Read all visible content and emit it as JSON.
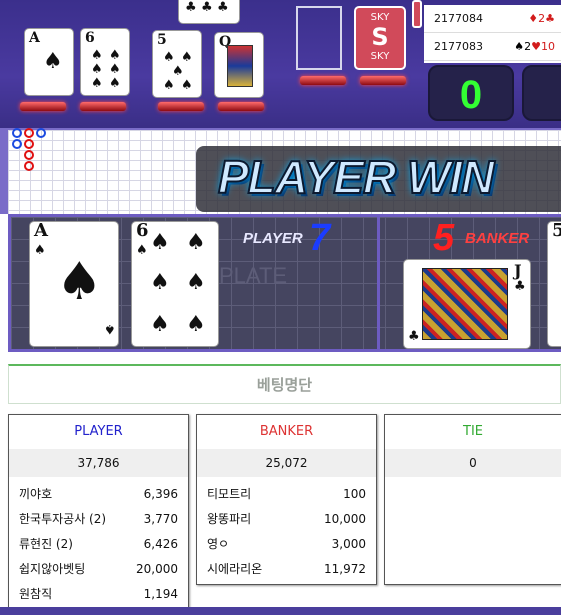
{
  "history": [
    {
      "round": "2177084",
      "result_dark": "",
      "result_red": "♦2♣"
    },
    {
      "round": "2177083",
      "result_dark": "♠2",
      "result_red": "♥10"
    }
  ],
  "scores_top": {
    "player_score": "0"
  },
  "banner": {
    "text": "PLAYER WIN"
  },
  "result": {
    "player_label": "PLAYER",
    "player_score": "7",
    "banker_label": "BANKER",
    "banker_score": "5",
    "plate_watermark": "PLATE"
  },
  "deck_card": {
    "top": "SKY",
    "mid": "S",
    "bottom": "SKY"
  },
  "betting": {
    "title": "베팅명단",
    "columns": [
      {
        "name": "PLAYER",
        "color": "#2222cc",
        "total": "37,786",
        "rows": [
          {
            "user": "끼야호",
            "amount": "6,396"
          },
          {
            "user": "한국투자공사 (2)",
            "amount": "3,770"
          },
          {
            "user": "류현진 (2)",
            "amount": "6,426"
          },
          {
            "user": "쉽지않아벳팅",
            "amount": "20,000"
          },
          {
            "user": "원참직",
            "amount": "1,194"
          }
        ]
      },
      {
        "name": "BANKER",
        "color": "#dd3333",
        "total": "25,072",
        "rows": [
          {
            "user": "티모트리",
            "amount": "100"
          },
          {
            "user": "왕똥파리",
            "amount": "10,000"
          },
          {
            "user": "영ㅇ",
            "amount": "3,000"
          },
          {
            "user": "시에라리온",
            "amount": "11,972"
          }
        ]
      },
      {
        "name": "TIE",
        "color": "#33aa33",
        "total": "0",
        "rows": []
      }
    ]
  },
  "colors": {
    "accent": "#6d5cc2",
    "player": "#1b4ae0",
    "banker": "#e01010",
    "green": "#5cb85c"
  }
}
